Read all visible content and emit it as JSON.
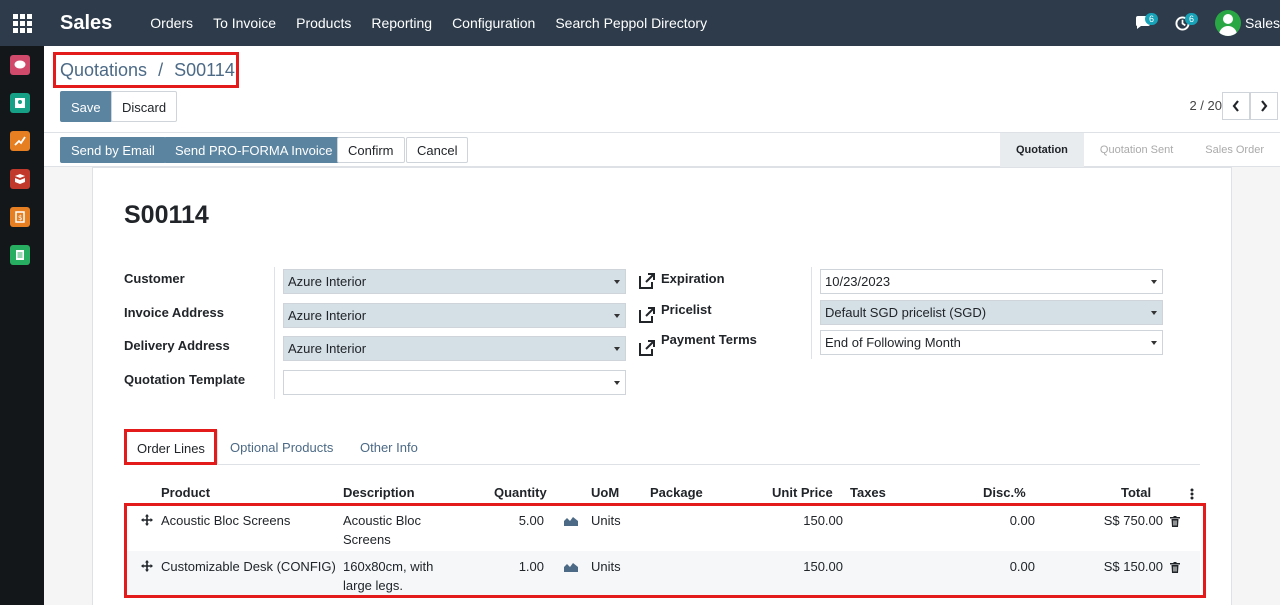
{
  "app": {
    "title": "Sales"
  },
  "topmenu": [
    "Orders",
    "To Invoice",
    "Products",
    "Reporting",
    "Configuration",
    "Search Peppol Directory"
  ],
  "systray": {
    "messages_count": "6",
    "activities_count": "6",
    "user_name": "Sales"
  },
  "sidebar": [
    "discuss-icon",
    "contacts-icon",
    "sales-icon",
    "inventory-icon",
    "invoicing-icon",
    "documents-icon"
  ],
  "breadcrumb": {
    "parent": "Quotations",
    "separator": "/",
    "current": "S00114"
  },
  "controls": {
    "save": "Save",
    "discard": "Discard",
    "pager": "2 / 20"
  },
  "statusbar": {
    "buttons": [
      "Send by Email",
      "Send PRO-FORMA Invoice",
      "Confirm",
      "Cancel"
    ],
    "stages": [
      "Quotation",
      "Quotation Sent",
      "Sales Order"
    ],
    "active_stage": "Quotation"
  },
  "form": {
    "name": "S00114",
    "customer_label": "Customer",
    "customer": "Azure Interior",
    "invoice_address_label": "Invoice Address",
    "invoice_address": "Azure Interior",
    "delivery_address_label": "Delivery Address",
    "delivery_address": "Azure Interior",
    "quotation_template_label": "Quotation Template",
    "quotation_template": "",
    "expiration_label": "Expiration",
    "expiration": "10/23/2023",
    "pricelist_label": "Pricelist",
    "pricelist": "Default SGD pricelist (SGD)",
    "payment_terms_label": "Payment Terms",
    "payment_terms": "End of Following Month"
  },
  "tabs": [
    "Order Lines",
    "Optional Products",
    "Other Info"
  ],
  "table": {
    "headers": [
      "Product",
      "Description",
      "Quantity",
      "UoM",
      "Package",
      "Unit Price",
      "Taxes",
      "Disc.%",
      "Total"
    ],
    "rows": [
      {
        "product": "Acoustic Bloc Screens",
        "description_1": "Acoustic Bloc",
        "description_2": "Screens",
        "quantity": "5.00",
        "uom": "Units",
        "package": "",
        "unit_price": "150.00",
        "taxes": "",
        "discount": "0.00",
        "total": "S$ 750.00"
      },
      {
        "product": "Customizable Desk (CONFIG)",
        "description_1": "160x80cm, with",
        "description_2": "large legs.",
        "quantity": "1.00",
        "uom": "Units",
        "package": "",
        "unit_price": "150.00",
        "taxes": "",
        "discount": "0.00",
        "total": "S$ 150.00"
      }
    ]
  },
  "colors": {
    "navbar": "#2d3b4a",
    "primary": "#5b84a1",
    "highlight": "#e31b1b",
    "link": "#4c6a86"
  }
}
